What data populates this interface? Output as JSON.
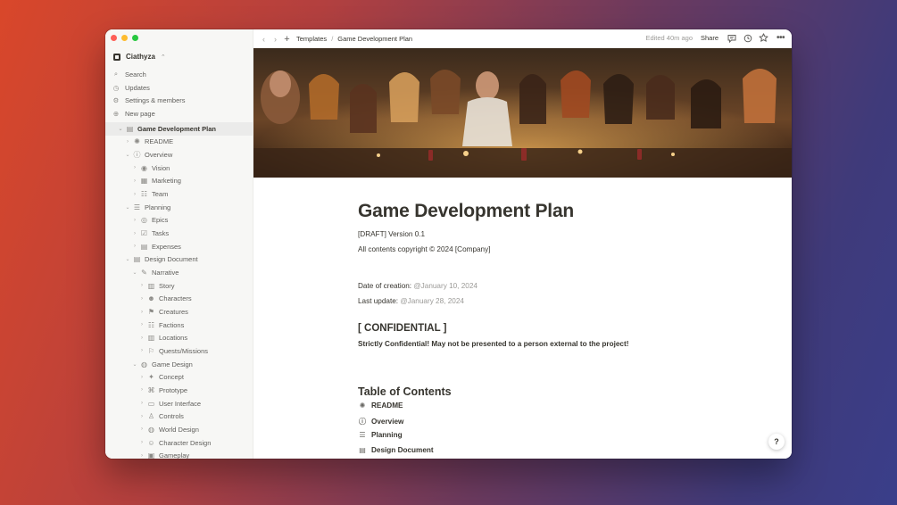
{
  "workspace": {
    "name": "Ciathyza",
    "chevron": "⌃"
  },
  "menu": [
    {
      "label": "Search",
      "icon": "search-icon",
      "glyph": "⌕"
    },
    {
      "label": "Updates",
      "icon": "clock-icon",
      "glyph": "◷"
    },
    {
      "label": "Settings & members",
      "icon": "gear-icon",
      "glyph": "⚙"
    },
    {
      "label": "New page",
      "icon": "plus-circle-icon",
      "glyph": "⊕"
    }
  ],
  "tree": [
    {
      "label": "Game Development Plan",
      "level": 0,
      "open": true,
      "selected": true,
      "glyph": "▤",
      "icon": "page-icon"
    },
    {
      "label": "README",
      "level": 1,
      "open": false,
      "glyph": "✺",
      "icon": "sparkle-icon"
    },
    {
      "label": "Overview",
      "level": 1,
      "open": true,
      "glyph": "ⓘ",
      "icon": "info-icon"
    },
    {
      "label": "Vision",
      "level": 2,
      "open": false,
      "glyph": "◉",
      "icon": "eye-icon"
    },
    {
      "label": "Marketing",
      "level": 2,
      "open": false,
      "glyph": "▦",
      "icon": "store-icon"
    },
    {
      "label": "Team",
      "level": 2,
      "open": false,
      "glyph": "☷",
      "icon": "team-icon"
    },
    {
      "label": "Planning",
      "level": 1,
      "open": true,
      "glyph": "☰",
      "icon": "gantt-icon"
    },
    {
      "label": "Epics",
      "level": 2,
      "open": false,
      "glyph": "◎",
      "icon": "target-icon"
    },
    {
      "label": "Tasks",
      "level": 2,
      "open": false,
      "glyph": "☑",
      "icon": "checkbox-icon"
    },
    {
      "label": "Expenses",
      "level": 2,
      "open": false,
      "glyph": "▤",
      "icon": "receipt-icon"
    },
    {
      "label": "Design Document",
      "level": 1,
      "open": true,
      "glyph": "▤",
      "icon": "document-icon"
    },
    {
      "label": "Narrative",
      "level": 2,
      "open": true,
      "glyph": "✎",
      "icon": "pencil-icon"
    },
    {
      "label": "Story",
      "level": 3,
      "open": false,
      "glyph": "▥",
      "icon": "book-icon"
    },
    {
      "label": "Characters",
      "level": 3,
      "open": false,
      "glyph": "☻",
      "icon": "people-icon"
    },
    {
      "label": "Creatures",
      "level": 3,
      "open": false,
      "glyph": "⚑",
      "icon": "creature-icon"
    },
    {
      "label": "Factions",
      "level": 3,
      "open": false,
      "glyph": "☷",
      "icon": "group-icon"
    },
    {
      "label": "Locations",
      "level": 3,
      "open": false,
      "glyph": "▥",
      "icon": "building-icon"
    },
    {
      "label": "Quests/Missions",
      "level": 3,
      "open": false,
      "glyph": "⚐",
      "icon": "quest-icon"
    },
    {
      "label": "Game Design",
      "level": 2,
      "open": true,
      "glyph": "◍",
      "icon": "palette-icon"
    },
    {
      "label": "Concept",
      "level": 3,
      "open": false,
      "glyph": "✦",
      "icon": "lightbulb-icon"
    },
    {
      "label": "Prototype",
      "level": 3,
      "open": false,
      "glyph": "⌘",
      "icon": "prototype-icon"
    },
    {
      "label": "User Interface",
      "level": 3,
      "open": false,
      "glyph": "▭",
      "icon": "monitor-icon"
    },
    {
      "label": "Controls",
      "level": 3,
      "open": false,
      "glyph": "♙",
      "icon": "joystick-icon"
    },
    {
      "label": "World Design",
      "level": 3,
      "open": false,
      "glyph": "◍",
      "icon": "globe-icon"
    },
    {
      "label": "Character Design",
      "level": 3,
      "open": false,
      "glyph": "☺",
      "icon": "person-icon"
    },
    {
      "label": "Gameplay",
      "level": 3,
      "open": false,
      "glyph": "▣",
      "icon": "gameplay-icon"
    }
  ],
  "topbar": {
    "breadcrumb": [
      "Templates",
      "Game Development Plan"
    ],
    "separator": "/",
    "edited": "Edited 40m ago",
    "share": "Share"
  },
  "page": {
    "title": "Game Development Plan",
    "version": "[DRAFT] Version 0.1",
    "copyright": "All contents copyright © 2024 [Company]",
    "creation_label": "Date of creation: ",
    "creation_date": "@January 10, 2024",
    "update_label": "Last update: ",
    "update_date": "@January 28, 2024",
    "confidential_heading": "[ CONFIDENTIAL ]",
    "confidential_text": "Strictly Confidential! May not be presented to a person external to the project!",
    "toc_heading": "Table of Contents",
    "toc": [
      {
        "label": "README",
        "glyph": "✺",
        "icon": "sparkle-icon"
      },
      {
        "label": "Overview",
        "glyph": "ⓘ",
        "icon": "info-icon"
      },
      {
        "label": "Planning",
        "glyph": "☰",
        "icon": "gantt-icon"
      },
      {
        "label": "Design Document",
        "glyph": "▤",
        "icon": "document-icon"
      }
    ]
  },
  "help": "?"
}
